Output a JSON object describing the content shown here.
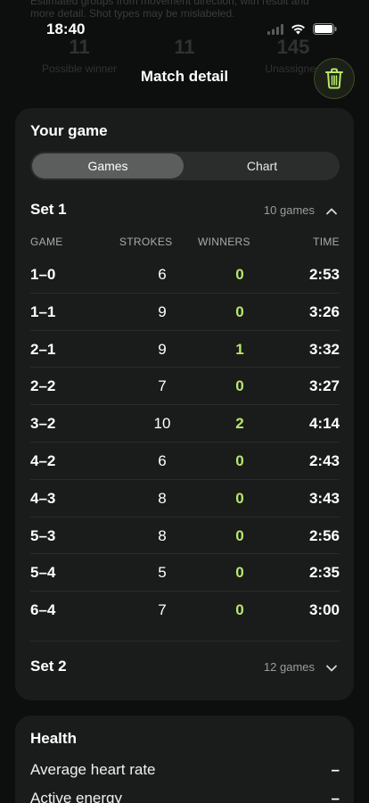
{
  "background": {
    "text_line1": "Estimated groups from movement direction, with result and",
    "text_line2": "more detail. Shot types may be mislabeled.",
    "stats": [
      {
        "value": "11",
        "label": "Possible winner"
      },
      {
        "value": "11",
        "label": ""
      },
      {
        "value": "145",
        "label": "Unassigned"
      }
    ]
  },
  "status_bar": {
    "time": "18:40"
  },
  "nav": {
    "title": "Match detail",
    "trash_icon": "trash-icon"
  },
  "game_card": {
    "title": "Your game",
    "tabs": [
      {
        "label": "Games",
        "active": true
      },
      {
        "label": "Chart",
        "active": false
      }
    ],
    "set1": {
      "label": "Set 1",
      "count": "10 games",
      "expanded": true
    },
    "columns": {
      "game": "GAME",
      "strokes": "STROKES",
      "winners": "WINNERS",
      "time": "TIME"
    },
    "games": [
      {
        "game": "1–0",
        "strokes": "6",
        "winners": "0",
        "time": "2:53"
      },
      {
        "game": "1–1",
        "strokes": "9",
        "winners": "0",
        "time": "3:26"
      },
      {
        "game": "2–1",
        "strokes": "9",
        "winners": "1",
        "time": "3:32"
      },
      {
        "game": "2–2",
        "strokes": "7",
        "winners": "0",
        "time": "3:27"
      },
      {
        "game": "3–2",
        "strokes": "10",
        "winners": "2",
        "time": "4:14"
      },
      {
        "game": "4–2",
        "strokes": "6",
        "winners": "0",
        "time": "2:43"
      },
      {
        "game": "4–3",
        "strokes": "8",
        "winners": "0",
        "time": "3:43"
      },
      {
        "game": "5–3",
        "strokes": "8",
        "winners": "0",
        "time": "2:56"
      },
      {
        "game": "5–4",
        "strokes": "5",
        "winners": "0",
        "time": "2:35"
      },
      {
        "game": "6–4",
        "strokes": "7",
        "winners": "0",
        "time": "3:00"
      }
    ],
    "set2": {
      "label": "Set 2",
      "count": "12 games",
      "expanded": false
    }
  },
  "health_card": {
    "title": "Health",
    "rows": [
      {
        "label": "Average heart rate",
        "value": "–"
      },
      {
        "label": "Active energy",
        "value": "–"
      }
    ]
  },
  "colors": {
    "accent": "#b8e86a",
    "card": "#1a1b1b",
    "background": "#0d0e0e"
  }
}
